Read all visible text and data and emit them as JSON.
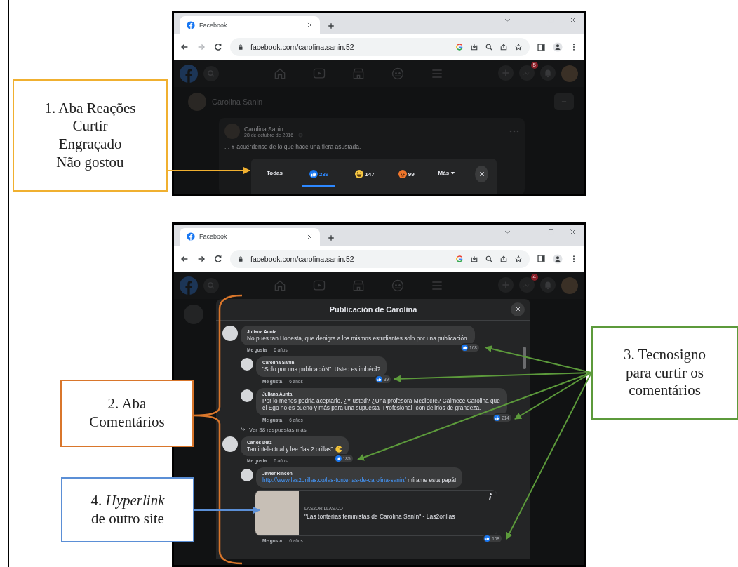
{
  "figure_panels": [
    {
      "kind": "reactions",
      "browser": {
        "tab_title": "Facebook",
        "url": "facebook.com/carolina.sanin.52",
        "forward_disabled": true,
        "notification_count": "5"
      },
      "profile_name": "Carolina Sanin",
      "post": {
        "author": "Carolina Sanin",
        "date": "28 de octubre de 2016 ·",
        "text": "... Y acuérdense de lo que hace una fiera asustada."
      },
      "reaction_tabs": [
        {
          "kind": "text",
          "label": "Todas",
          "selected": false
        },
        {
          "kind": "like",
          "label": "239",
          "selected": true
        },
        {
          "kind": "haha",
          "label": "147",
          "selected": false
        },
        {
          "kind": "angry",
          "label": "99",
          "selected": false
        },
        {
          "kind": "more",
          "label": "Más",
          "selected": false
        }
      ]
    },
    {
      "kind": "comments",
      "browser": {
        "tab_title": "Facebook",
        "url": "facebook.com/carolina.sanin.52",
        "forward_disabled": false,
        "notification_count": "4"
      },
      "modal_title": "Publicación de Carolina",
      "comments": [
        {
          "author": "Juliana Aunta",
          "text": "No pues tan Honesta, que denigra a los mismos estudiantes solo por una publicación.",
          "likes": "168",
          "action": "Me gusta",
          "time": "6 años",
          "children": [
            {
              "author": "Carolina Sanín",
              "text": "\"Solo por una publicacióN\": Usted es imbécil?",
              "likes": "39",
              "action": "Me gusta",
              "time": "6 años"
            },
            {
              "author": "Juliana Aunta",
              "text": "Por lo menos podría aceptarlo, ¿Y usted? ¿Una profesora Mediocre? Calmece Carolina que el Ego no es bueno y más para una supuesta ¨Profesional¨ con delirios de grandeza.",
              "likes": "214",
              "action": "Me gusta",
              "time": "6 años"
            }
          ],
          "more_replies": "Ver 38 respuestas más"
        },
        {
          "author": "Carlos Díaz",
          "text": "Tan intelectual y lee \"las 2 orillas\"",
          "emoji": true,
          "likes": "185",
          "action": "Me gusta",
          "time": "6 años",
          "children": [
            {
              "author": "Javier Rincón",
              "link": "http://www.las2orillas.co/las-tonterias-de-carolina-sanin/",
              "text": "mírame esta papá!",
              "preview": {
                "domain": "LAS2ORILLAS.CO",
                "title": "\"Las tonterías feministas de Carolina Sanín\" - Las2orillas"
              },
              "likes": "108",
              "action": "Me gusta",
              "time": "6 años"
            }
          ]
        }
      ]
    }
  ],
  "annotations": [
    {
      "lines": [
        "1. Aba Reações",
        "Curtir",
        "Engraçado",
        "Não gostou"
      ],
      "color": "#f0b030"
    },
    {
      "lines": [
        "2. Aba",
        "Comentários"
      ],
      "color": "#d9762b"
    },
    {
      "lines": [
        "3. Tecnosigno",
        "para curtir os",
        "comentários"
      ],
      "color": "#5c9a3b"
    },
    {
      "lines": [
        "4. *Hyperlink*",
        "de outro site"
      ],
      "color": "#5b8fd6"
    }
  ]
}
